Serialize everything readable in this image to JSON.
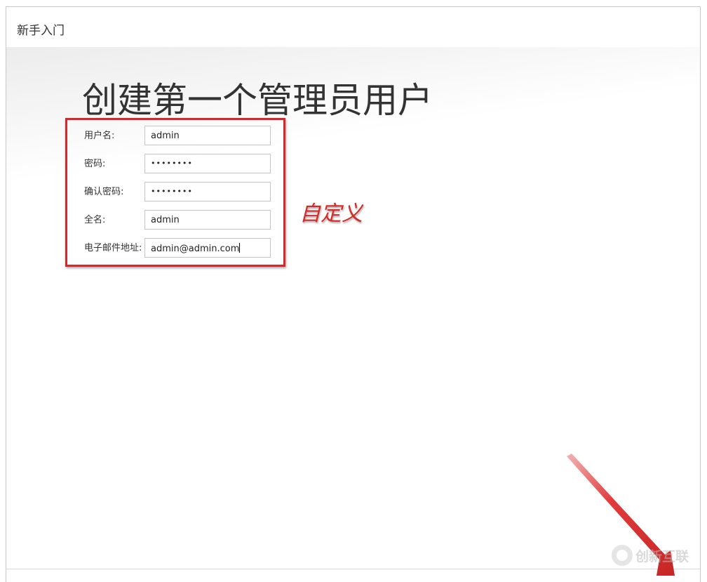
{
  "dialog": {
    "title": "新手入门"
  },
  "page": {
    "heading": "创建第一个管理员用户"
  },
  "form": {
    "fields": [
      {
        "label": "用户名:",
        "value": "admin",
        "type": "text"
      },
      {
        "label": "密码:",
        "value": "••••••••",
        "type": "password"
      },
      {
        "label": "确认密码:",
        "value": "••••••••",
        "type": "password"
      },
      {
        "label": "全名:",
        "value": "admin",
        "type": "text"
      },
      {
        "label": "电子邮件地址:",
        "value": "admin@admin.com",
        "type": "text"
      }
    ]
  },
  "annotation": {
    "text": "自定义",
    "color": "#d9262b"
  },
  "watermark": {
    "text": "创新互联"
  }
}
